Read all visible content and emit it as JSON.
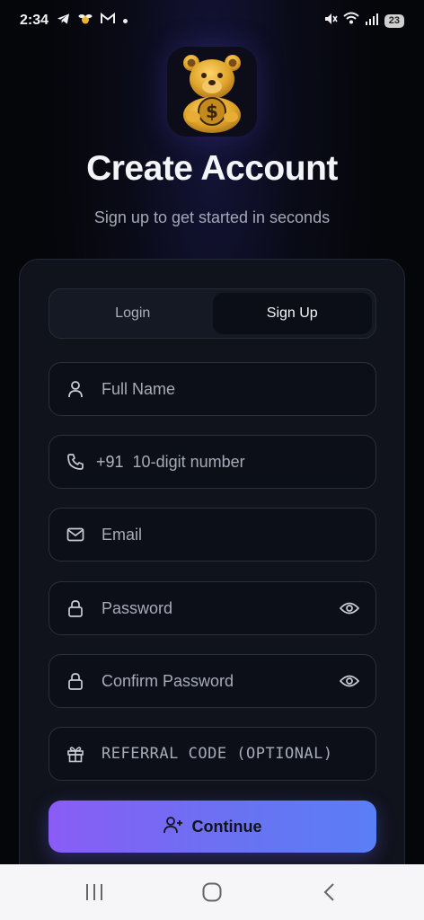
{
  "status_bar": {
    "time": "2:34",
    "battery": "23",
    "icons": [
      "telegram-icon",
      "bee-icon",
      "gmail-icon",
      "dot-icon",
      "mute-icon",
      "wifi-icon",
      "signal-icon",
      "battery-icon"
    ]
  },
  "header": {
    "logo": "bear-dollar-logo",
    "title": "Create Account",
    "subtitle": "Sign up to get started in seconds"
  },
  "tabs": [
    {
      "label": "Login",
      "active": false
    },
    {
      "label": "Sign Up",
      "active": true
    }
  ],
  "form": {
    "full_name": {
      "placeholder": "Full Name",
      "icon": "user-icon"
    },
    "phone": {
      "prefix": "+91",
      "placeholder": "10-digit number",
      "icon": "phone-icon"
    },
    "email": {
      "placeholder": "Email",
      "icon": "mail-icon"
    },
    "password": {
      "placeholder": "Password",
      "icon": "lock-icon"
    },
    "confirm_password": {
      "placeholder": "Confirm Password",
      "icon": "lock-icon"
    },
    "referral": {
      "placeholder": "REFERRAL CODE (OPTIONAL)",
      "icon": "gift-icon"
    }
  },
  "continue_label": "Continue",
  "colors": {
    "accent_start": "#8a5cf6",
    "accent_end": "#5a7ef5",
    "card_bg": "#10131c",
    "logo_gold": "#e0a52a"
  },
  "nav_bar": [
    "recents-icon",
    "home-icon",
    "back-icon"
  ]
}
